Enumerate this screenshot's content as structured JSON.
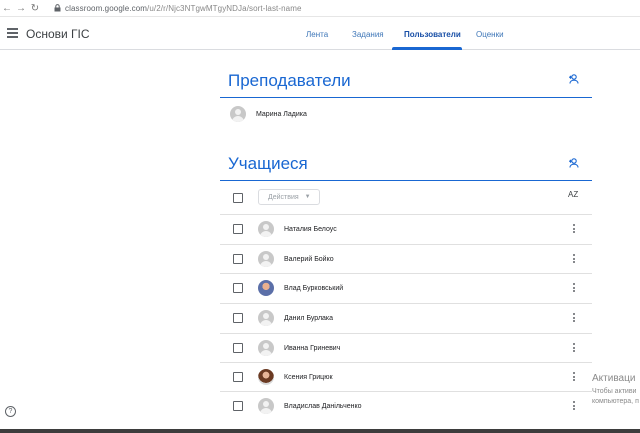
{
  "browser": {
    "back_icon": "arrow-left-icon",
    "forward_icon": "arrow-right-icon",
    "reload_icon": "reload-icon",
    "url_host": "classroom.google.com",
    "url_path": "/u/2/r/Njc3NTgwMTgyNDJa/sort-last-name"
  },
  "app": {
    "class_name": "Основи ГІС",
    "tabs": [
      {
        "label": "Лента"
      },
      {
        "label": "Задания"
      },
      {
        "label": "Пользователи"
      },
      {
        "label": "Оценки"
      }
    ]
  },
  "teachers": {
    "title": "Преподаватели",
    "list": [
      {
        "name": "Марина Ладика"
      }
    ]
  },
  "students": {
    "title": "Учащиеся",
    "actions_label": "Действия",
    "sort_label": "AZ",
    "list": [
      {
        "name": "Наталия Белоус",
        "avatar": "default"
      },
      {
        "name": "Валерий Бойко",
        "avatar": "default"
      },
      {
        "name": "Влад Бурковський",
        "avatar": "photo"
      },
      {
        "name": "Данил Бурлака",
        "avatar": "default"
      },
      {
        "name": "Иванна Гриневич",
        "avatar": "default"
      },
      {
        "name": "Ксения Грицюк",
        "avatar": "photo"
      },
      {
        "name": "Владислав Данільченко",
        "avatar": "default"
      }
    ]
  },
  "watermark": {
    "line1": "Активаци",
    "line2": "Чтобы активи",
    "line3": "компьютера, п"
  },
  "colors": {
    "accent": "#1967d2",
    "tab_text": "#3f77b8"
  }
}
